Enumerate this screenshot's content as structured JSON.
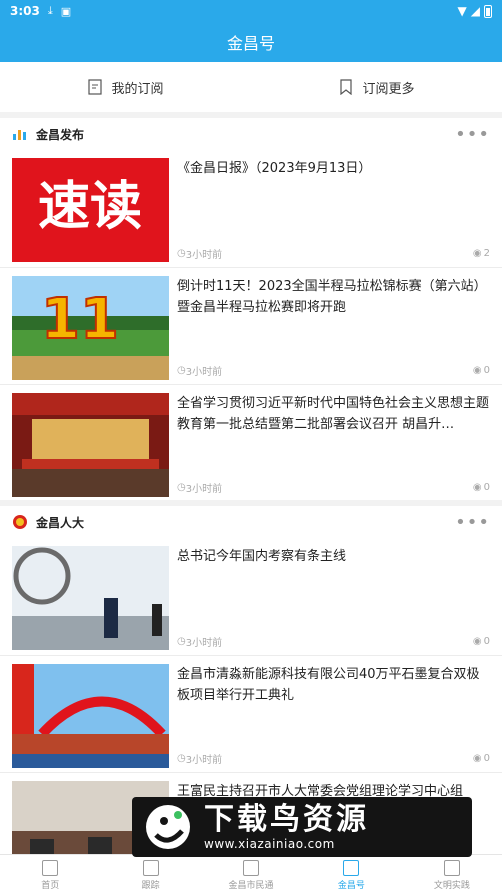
{
  "status": {
    "time": "3:03"
  },
  "header": {
    "title": "金昌号"
  },
  "subnav": [
    {
      "label": "我的订阅"
    },
    {
      "label": "订阅更多"
    }
  ],
  "sections": [
    {
      "name": "金昌发布",
      "items": [
        {
          "thumb_text": "速读",
          "title": "《金昌日报》（2023年9月13日）",
          "time": "3小时前",
          "views": "2"
        },
        {
          "thumb_text": "11",
          "title": "倒计时11天！2023全国半程马拉松锦标赛（第六站）暨金昌半程马拉松赛即将开跑",
          "time": "3小时前",
          "views": "0"
        },
        {
          "title": "全省学习贯彻习近平新时代中国特色社会主义思想主题教育第一批总结暨第二批部署会议召开 胡昌升…",
          "time": "3小时前",
          "views": "0"
        }
      ]
    },
    {
      "name": "金昌人大",
      "items": [
        {
          "title": "总书记今年国内考察有条主线",
          "time": "3小时前",
          "views": "0"
        },
        {
          "title": "金昌市清淼新能源科技有限公司40万平石墨复合双极板项目举行开工典礼",
          "time": "3小时前",
          "views": "0"
        },
        {
          "title": "王富民主持召开市人大常委会党组理论学习中心组"
        }
      ]
    }
  ],
  "bottom_nav": [
    {
      "label": "首页"
    },
    {
      "label": "跟踪"
    },
    {
      "label": "金昌市民通"
    },
    {
      "label": "金昌号"
    },
    {
      "label": "文明实践"
    }
  ],
  "watermark": {
    "text": "下载鸟资源",
    "url": "www.xiazainiao.com"
  },
  "colors": {
    "accent": "#2aa9ea"
  }
}
